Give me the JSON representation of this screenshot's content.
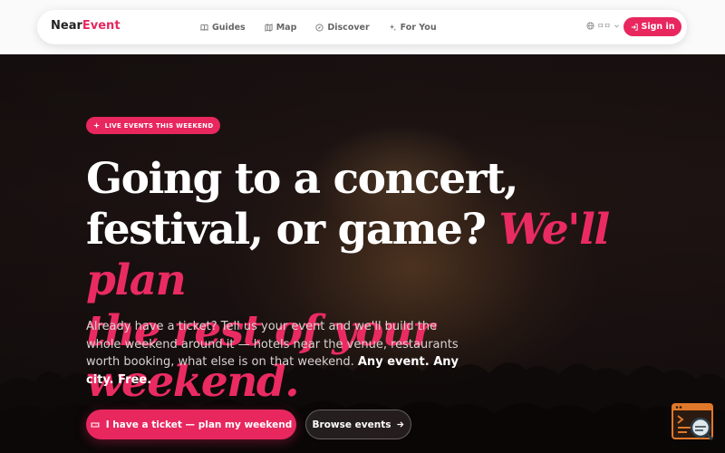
{
  "brand": {
    "name_part1": "Near",
    "name_part2": "Event"
  },
  "nav": {
    "items": [
      {
        "label": "Guides",
        "icon": "guides-icon"
      },
      {
        "label": "Map",
        "icon": "map-icon"
      },
      {
        "label": "Discover",
        "icon": "compass-icon"
      },
      {
        "label": "For You",
        "icon": "sparkle-icon"
      }
    ],
    "language_label": "ㅁㅁ",
    "signin_label": "Sign in"
  },
  "hero": {
    "badge": "LIVE EVENTS THIS WEEKEND",
    "headline_line1": "Going to a concert,",
    "headline_line2_plain": "festival, or game?",
    "headline_line2_accent": "We'll plan",
    "headline_line3_accent": "the rest of your weekend.",
    "sub_text": "Already have a ticket? Tell us your event and we'll build the whole weekend around it — hotels near the venue, restaurants worth booking, what else is on that weekend.",
    "sub_emphasis": "Any event. Any city. Free.",
    "primary_cta": "I have a ticket — plan my weekend",
    "secondary_cta": "Browse events"
  },
  "colors": {
    "accent": "#e8275f",
    "hero_dark": "#1b1312",
    "nav_bg": "#ffffff"
  }
}
